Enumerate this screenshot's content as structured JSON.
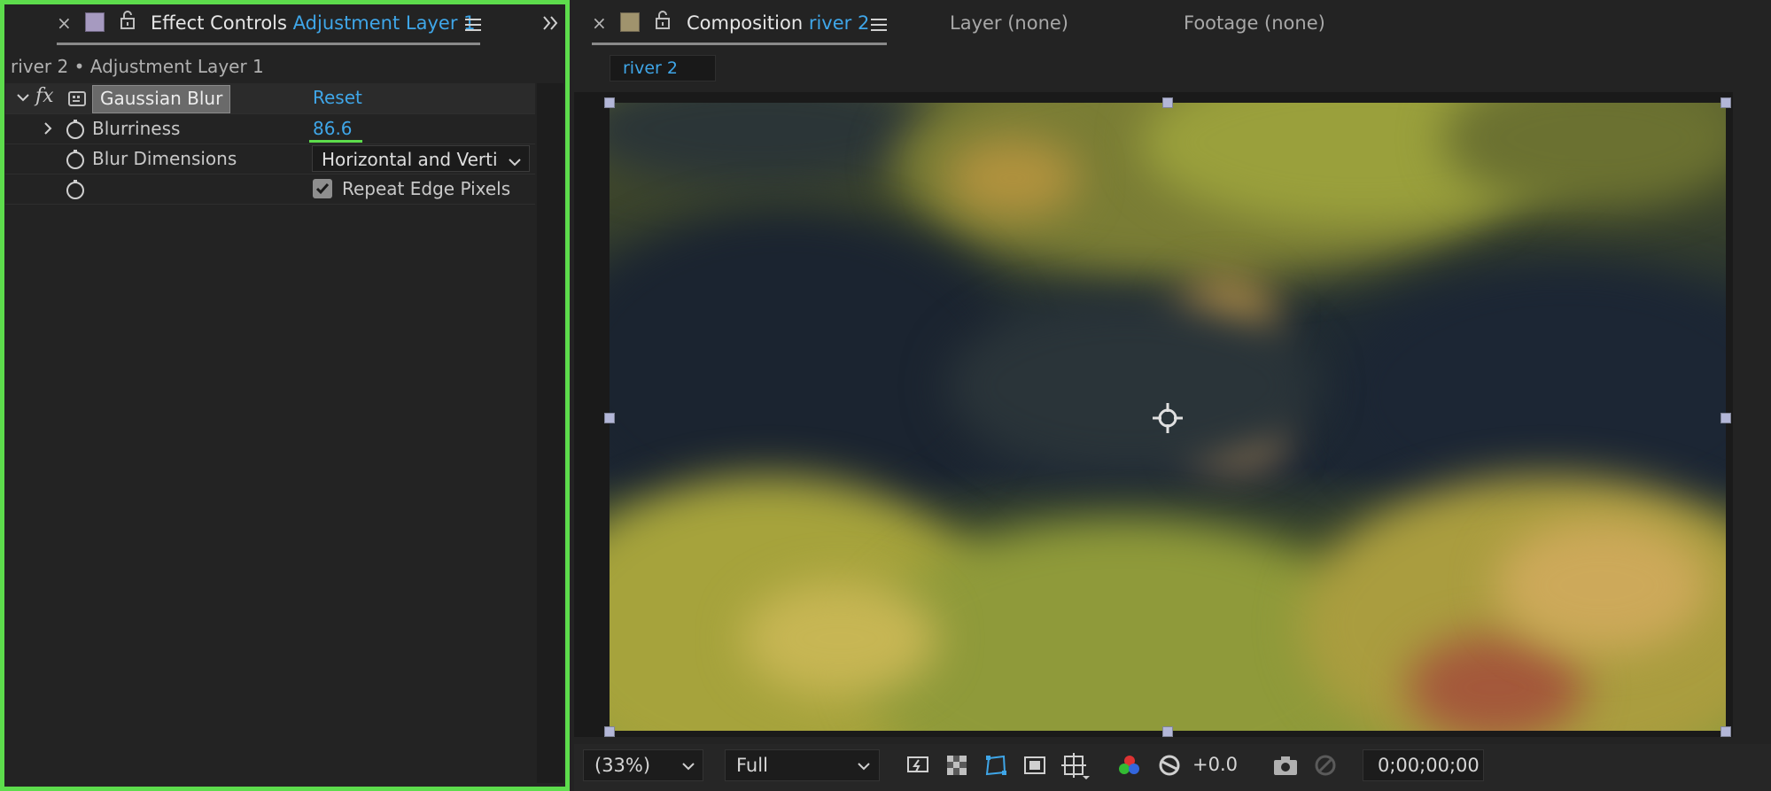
{
  "effect_controls": {
    "tab_title": "Effect Controls",
    "tab_layer": "Adjustment Layer 1",
    "layer_path": "river 2 • Adjustment Layer 1",
    "effect": {
      "fx_glyph": "fx",
      "name": "Gaussian Blur",
      "reset_label": "Reset"
    },
    "properties": [
      {
        "name": "Blurriness",
        "value": "86.6"
      },
      {
        "name": "Blur Dimensions",
        "value": "Horizontal and Verti"
      },
      {
        "name": "",
        "checkbox_label": "Repeat Edge Pixels",
        "checked": true
      }
    ]
  },
  "composition": {
    "tab_title": "Composition",
    "comp_name": "river 2",
    "layer_tab": "Layer (none)",
    "footage_tab": "Footage (none)",
    "subtab_label": "river 2"
  },
  "viewer_controls": {
    "zoom": "(33%)",
    "resolution": "Full",
    "exposure": "+0.0",
    "timecode": "0;00;00;00"
  },
  "colors": {
    "selection_border": "#5ddc4c",
    "accent_blue": "#3fa6e8",
    "panel_bg": "#232323",
    "handle": "#b3b7d8"
  },
  "icons": {
    "close": "close-icon",
    "lock": "lock-icon",
    "menu": "hamburger-menu-icon",
    "expand_panels": "double-chevron-right-icon",
    "stopwatch": "stopwatch-icon",
    "anchor": "anchor-point-icon"
  }
}
